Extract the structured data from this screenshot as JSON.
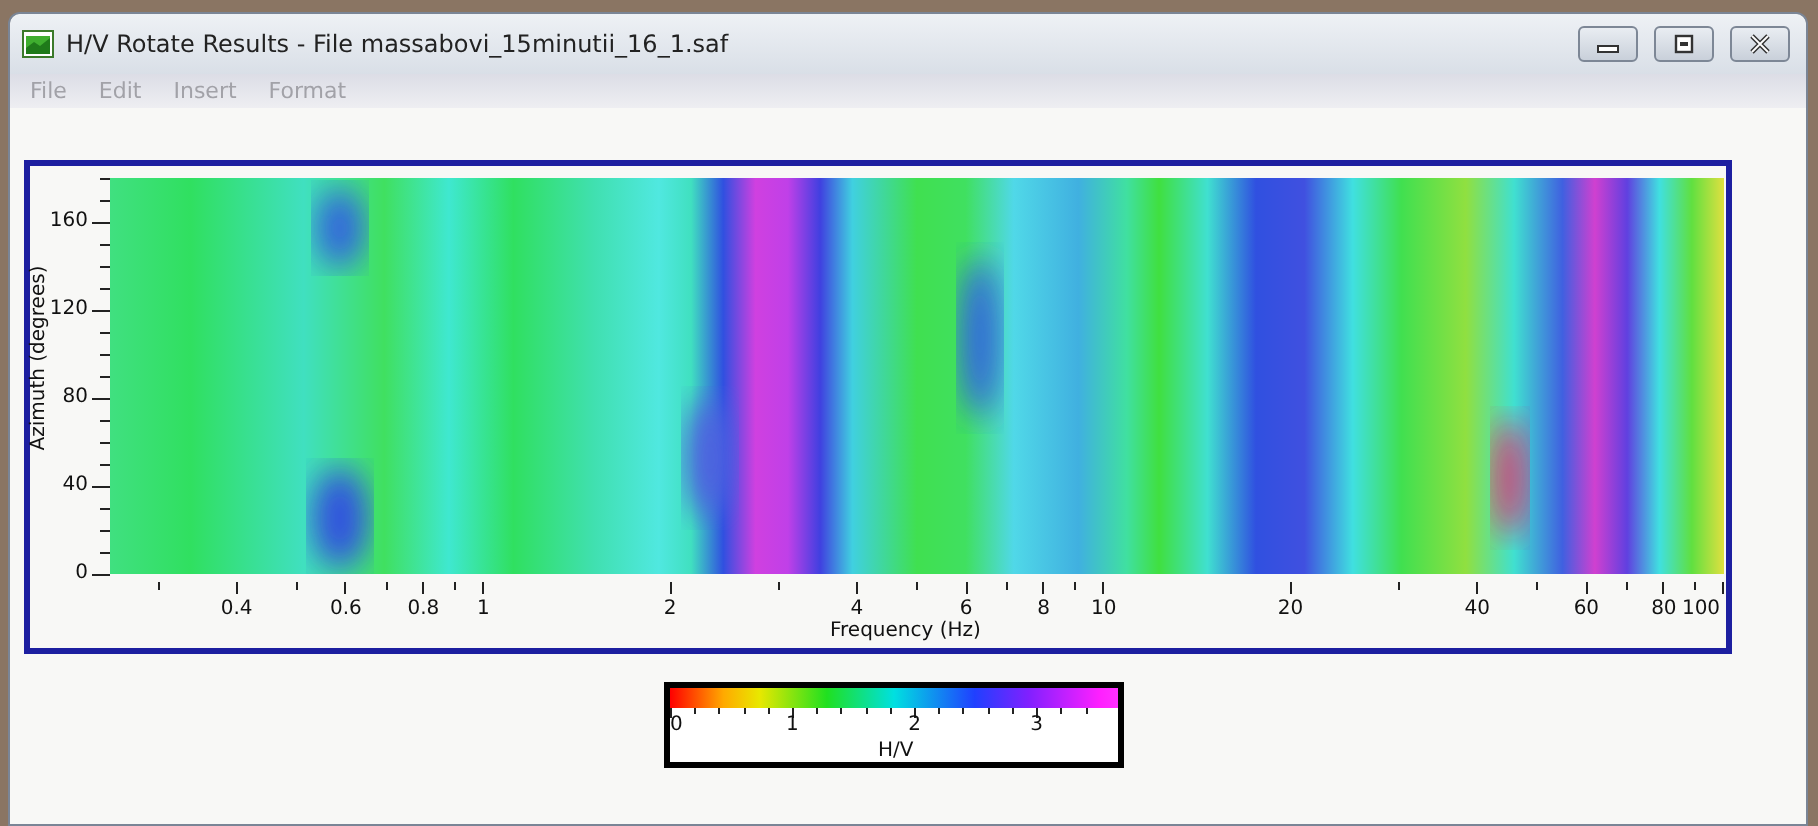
{
  "window": {
    "title": "H/V Rotate Results - File massabovi_15minutii_16_1.saf"
  },
  "menu": [
    {
      "label": "File",
      "disabled": true
    },
    {
      "label": "Edit",
      "disabled": true
    },
    {
      "label": "Insert",
      "disabled": true
    },
    {
      "label": "Format",
      "disabled": true
    }
  ],
  "plot": {
    "ylabel": "Azimuth (degrees)",
    "yticks": [
      "160",
      "120",
      "80",
      "40",
      "0"
    ],
    "xlabel": "Frequency (Hz)",
    "xticks": [
      "0.4",
      "0.6",
      "0.8",
      "1",
      "2",
      "4",
      "6",
      "8",
      "10",
      "20",
      "40",
      "60",
      "80",
      "100"
    ]
  },
  "colorbar": {
    "label": "H/V",
    "ticks": [
      "0",
      "1",
      "2",
      "3"
    ]
  }
}
